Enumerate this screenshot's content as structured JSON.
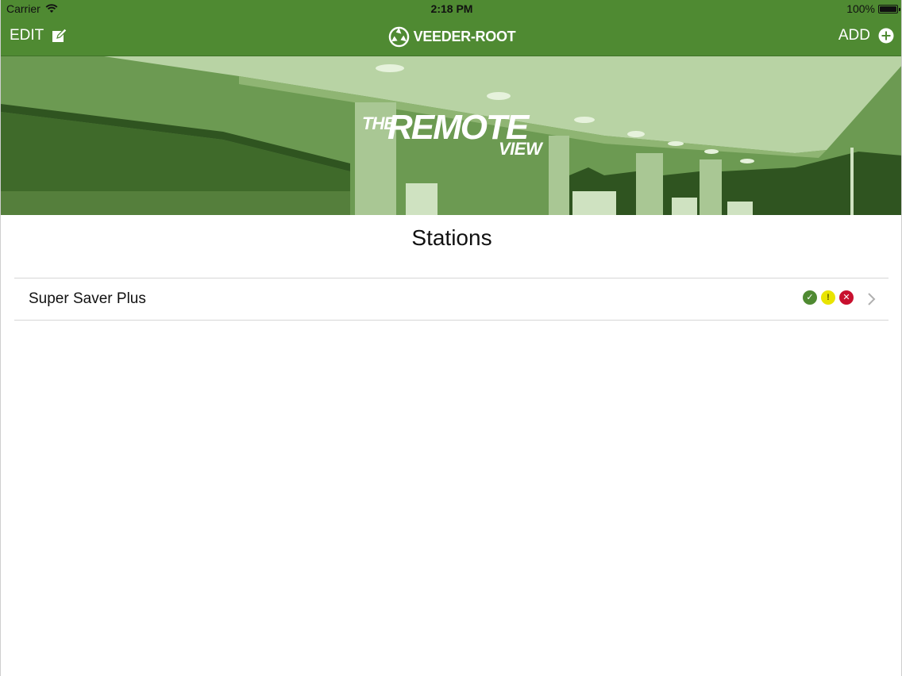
{
  "status_bar": {
    "carrier": "Carrier",
    "time": "2:18 PM",
    "battery": "100%"
  },
  "nav": {
    "edit_label": "EDIT",
    "logo_text": "VEEDER-ROOT",
    "add_label": "ADD"
  },
  "banner": {
    "the": "THE",
    "remote": "REMOTE",
    "view": "VIEW"
  },
  "page": {
    "title": "Stations"
  },
  "stations": [
    {
      "name": "Super Saver Plus",
      "status_icons": [
        "ok-icon",
        "warning-icon",
        "alarm-icon"
      ]
    }
  ],
  "colors": {
    "brand_green": "#4f8a32",
    "ok": "#4f8a32",
    "warning": "#e9e400",
    "alarm": "#c8102e"
  }
}
